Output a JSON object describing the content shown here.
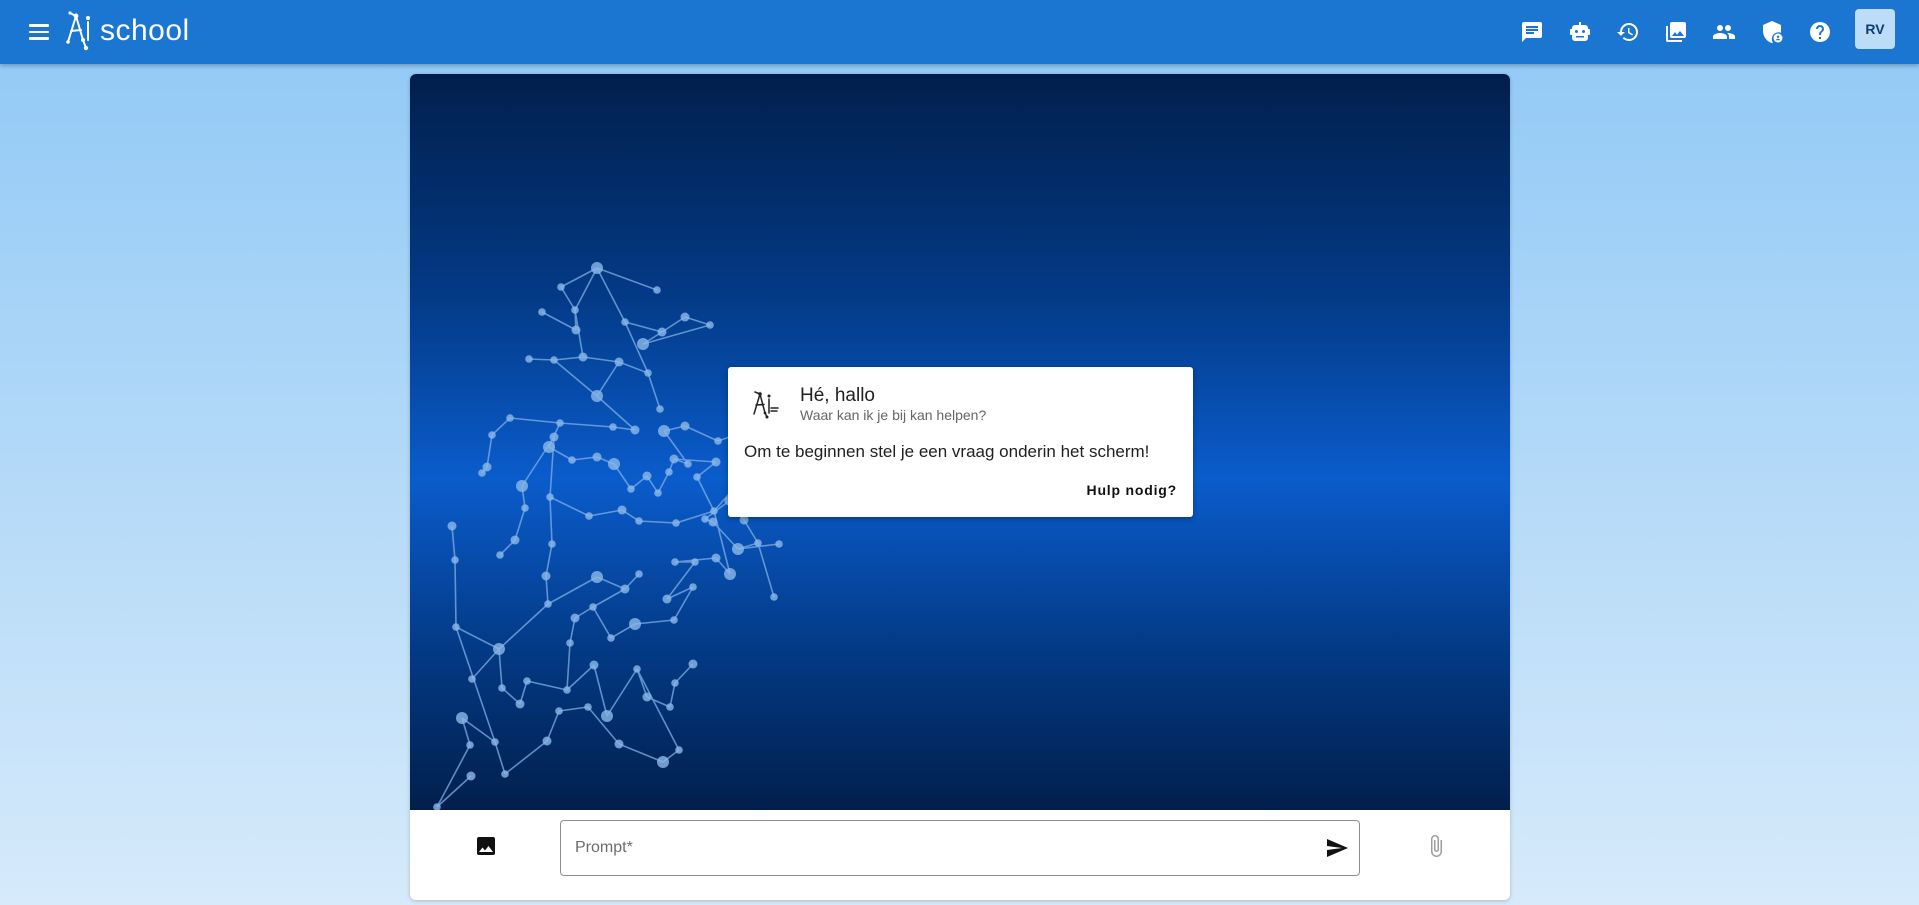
{
  "app": {
    "logo_text": "school"
  },
  "header": {
    "icons": [
      "chat-icon",
      "robot-icon",
      "history-icon",
      "gallery-icon",
      "people-icon",
      "admin-shield-icon",
      "help-icon"
    ],
    "avatar_initials": "RV"
  },
  "welcome": {
    "title": "Hé, hallo",
    "subtitle": "Waar kan ik je bij kan helpen?",
    "body": "Om te beginnen stel je een vraag onderin het scherm!",
    "help_label": "Hulp nodig?"
  },
  "prompt": {
    "placeholder": "Prompt*"
  },
  "colors": {
    "topbar": "#1b76d2",
    "avatar_bg": "#bcdcf7"
  }
}
